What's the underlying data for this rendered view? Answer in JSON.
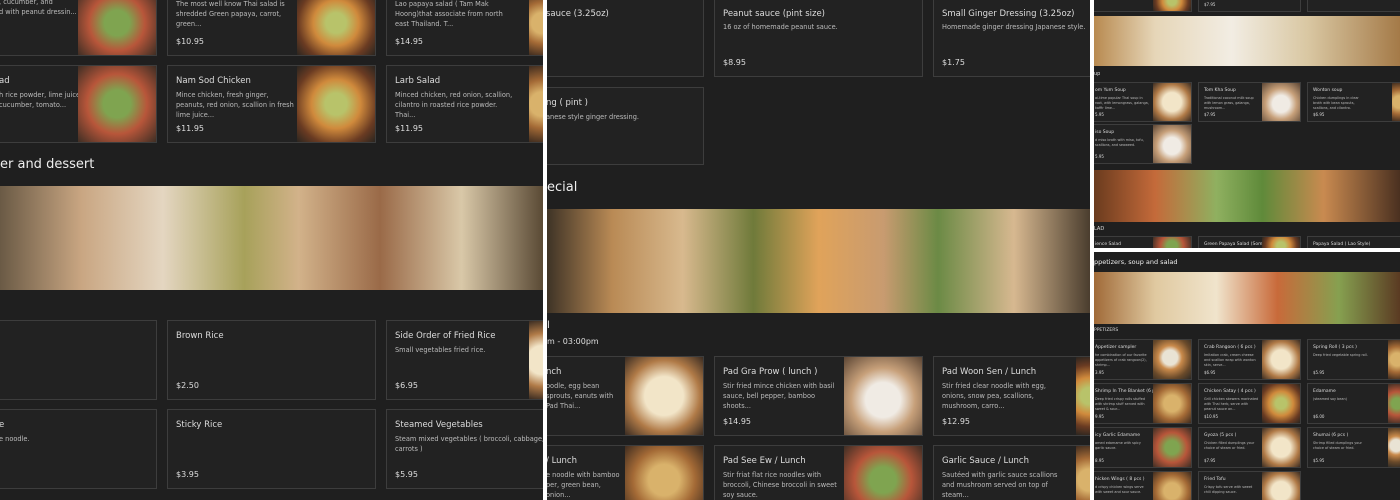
{
  "panel1": {
    "heading": "er and dessert",
    "cards": [
      {
        "name": "",
        "desc": ", cucumber, and\nd with peanut dressin...",
        "price": ""
      },
      {
        "name": "",
        "desc": "The most well know Thai salad is shredded Green papaya, carrot, green...",
        "price": "$10.95"
      },
      {
        "name": "",
        "desc": "Lao papaya salad ( Tam Mak Hoong)that associate from north east Thailand. T...",
        "price": "$14.95"
      },
      {
        "name": "ad",
        "desc": "h rice powder, lime juice, on, cucumber, tomato...",
        "price": ""
      },
      {
        "name": "Nam Sod Chicken",
        "desc": "Mince chicken, fresh ginger, peanuts, red onion, scallion in fresh lime juice...",
        "price": "$11.95"
      },
      {
        "name": "Larb Salad",
        "desc": "Minced chicken, red onion, scallion, cilantro in roasted rice powder. Thai...",
        "price": "$11.95"
      },
      {
        "name": "",
        "desc": "",
        "price": ""
      },
      {
        "name": "Brown Rice",
        "desc": "",
        "price": "$2.50"
      },
      {
        "name": "Side Order of Fried Rice",
        "desc": "Small vegetables fried rice.",
        "price": "$6.95"
      },
      {
        "name": "e",
        "desc": "e noodle.",
        "price": ""
      },
      {
        "name": "Sticky Rice",
        "desc": "",
        "price": "$3.95"
      },
      {
        "name": "Steamed Vegetables",
        "desc": "Steam mixed vegetables ( broccoli, cabbage, carrots )",
        "price": "$5.95"
      }
    ]
  },
  "panel2": {
    "heading": "ecial",
    "section": "l",
    "hours": "m - 03:00pm",
    "cards": [
      {
        "name": "sauce (3.25oz)",
        "desc": "",
        "price": ""
      },
      {
        "name": "Peanut sauce (pint size)",
        "desc": "16 oz of homemade peanut sauce.",
        "price": "$8.95"
      },
      {
        "name": "Small Ginger Dressing (3.25oz)",
        "desc": "Homemade ginger dressing Japanese style.",
        "price": "$1.75"
      },
      {
        "name": "ng ( pint )",
        "desc": "anese style ginger dressing.",
        "price": ""
      },
      {
        "name": "nch",
        "desc": "oodle, egg bean sprouts, eanuts with Pad Thai...",
        "price": ""
      },
      {
        "name": "Pad Gra Prow ( lunch )",
        "desc": "Stir fried mince chicken with basil sauce, bell pepper, bamboo shoots...",
        "price": "$14.95"
      },
      {
        "name": "Pad Woon Sen / Lunch",
        "desc": "Stir fried clear noodle with egg, onions, snow pea, scallions, mushroom, carro...",
        "price": "$12.95"
      },
      {
        "name": "/ Lunch",
        "desc": "e noodle with bamboo per, green bean, onion...",
        "price": ""
      },
      {
        "name": "Pad See Ew / Lunch",
        "desc": "Stir friat flat rice noodles with broccoli, Chinese broccoli in sweet soy sauce.",
        "price": ""
      },
      {
        "name": "Garlic Sauce / Lunch",
        "desc": "Sautéed with garlic sauce scallions and mushroom served on top of steam...",
        "price": ""
      }
    ]
  },
  "panel3": {
    "soup_label": "up",
    "salad_label": "LAD",
    "cards": [
      {
        "name": "",
        "desc": "",
        "price": ""
      },
      {
        "name": "",
        "desc": "",
        "price": "$7.95"
      },
      {
        "name": "",
        "desc": "",
        "price": ""
      },
      {
        "name": "om Yum Soup",
        "desc": "ai-time popular Thai soup in root, with lemongrass, galanga, kaffir lime...",
        "price": "5.95"
      },
      {
        "name": "Tom Kha Soup",
        "desc": "Traditional coconut milk soup with lemon grass, galanga, mushroom...",
        "price": "$7.95"
      },
      {
        "name": "Wonton soup",
        "desc": "Chicken dumplings in clear broth with bean sprouts, scallions, and cilantro.",
        "price": "$6.95"
      },
      {
        "name": "iso Soup",
        "desc": "d miso broth with miso, tofu, scallions, and seaweed.",
        "price": "5.95"
      },
      {
        "name": "ience Salad",
        "desc": "",
        "price": ""
      },
      {
        "name": "Green Papaya Salad (Som Tum)",
        "desc": "",
        "price": ""
      },
      {
        "name": "Papaya Salad ( Lao Style)",
        "desc": "",
        "price": ""
      }
    ]
  },
  "panel4": {
    "heading": "ppetizers, soup and salad",
    "section": "PPETIZERS",
    "cards": [
      {
        "name": "Appetizer sampler",
        "desc": "he combination of our favorite appetizers of crab rangoon(2), shrimp...",
        "price": "3.95"
      },
      {
        "name": "Crab Rangoon ( 6 pcs )",
        "desc": "Imitation crab, cream cheese and scallion wrap with wonton skin, serve...",
        "price": "$6.95"
      },
      {
        "name": "Spring Roll ( 3 pcs )",
        "desc": "Deep fried vegetable spring roll.",
        "price": "$5.95"
      },
      {
        "name": "Shrimp In The Blanket (6 pcs)",
        "desc": "Deep fried crispy rolls stuffed with shrimp stuff served with sweet & sour...",
        "price": "9.95"
      },
      {
        "name": "Chicken Satay ( 4 pcs )",
        "desc": "Grill chicken skewers marinated with Thai herb, serve with peanut sauce an...",
        "price": "$10.95"
      },
      {
        "name": "Edamame",
        "desc": "(steamed soy bean)",
        "price": "$6.00"
      },
      {
        "name": "icy Garlic Edamame",
        "desc": "amed edamame with spicy garlic sauce.",
        "price": "8.95"
      },
      {
        "name": "Gyoza (5 pcs )",
        "desc": "Chicken filled dumplings your choice of steam or fried.",
        "price": "$7.95"
      },
      {
        "name": "Shumai (6 pcs )",
        "desc": "Shrimp filled dumplings your choice of steam or fried.",
        "price": "$5.95"
      },
      {
        "name": "hicken Wings ( 8 pcs )",
        "desc": "d crispy chicken wings serve with sweet and sour sauce.",
        "price": ""
      },
      {
        "name": "Fried Tofu",
        "desc": "Crispy tofu serve with sweet chili dipping sauce.",
        "price": ""
      }
    ]
  }
}
